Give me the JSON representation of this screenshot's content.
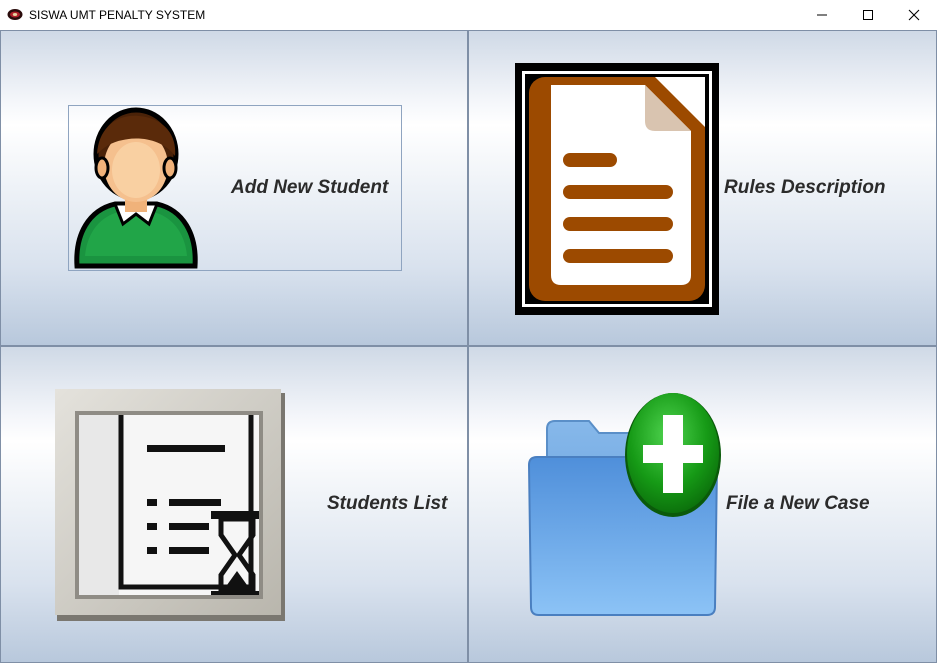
{
  "window": {
    "title": "SISWA UMT PENALTY SYSTEM",
    "controls": [
      "minimize",
      "maximize",
      "close"
    ]
  },
  "menu": [
    {
      "label": "Add New Student",
      "icon": "student-avatar-icon"
    },
    {
      "label": "Rules Description",
      "icon": "document-icon"
    },
    {
      "label": "Students List",
      "icon": "pending-list-icon"
    },
    {
      "label": "File a New Case",
      "icon": "add-folder-icon"
    }
  ],
  "colors": {
    "document_brown": "#9c4a00",
    "folder_blue": "#6fa8e6",
    "plus_green": "#1a9a1a",
    "shirt_green": "#1e9e45",
    "label_text": "#2b2b2b"
  }
}
